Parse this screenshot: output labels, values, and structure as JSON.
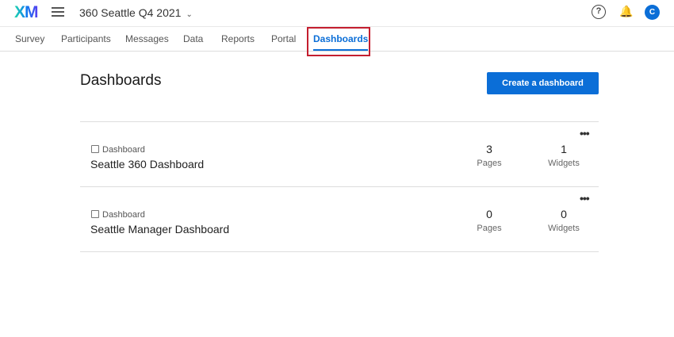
{
  "header": {
    "logo": "XM",
    "project": "360 Seattle Q4 2021",
    "avatar": "C",
    "help": "?"
  },
  "tabs": [
    "Survey",
    "Participants",
    "Messages",
    "Data",
    "Reports",
    "Portal",
    "Dashboards"
  ],
  "page": {
    "title": "Dashboards",
    "create_label": "Create a dashboard"
  },
  "dashboards": [
    {
      "type": "Dashboard",
      "name": "Seattle 360 Dashboard",
      "pages": "3",
      "pages_label": "Pages",
      "widgets": "1",
      "widgets_label": "Widgets",
      "more": "•••"
    },
    {
      "type": "Dashboard",
      "name": "Seattle Manager Dashboard",
      "pages": "0",
      "pages_label": "Pages",
      "widgets": "0",
      "widgets_label": "Widgets",
      "more": "•••"
    }
  ]
}
